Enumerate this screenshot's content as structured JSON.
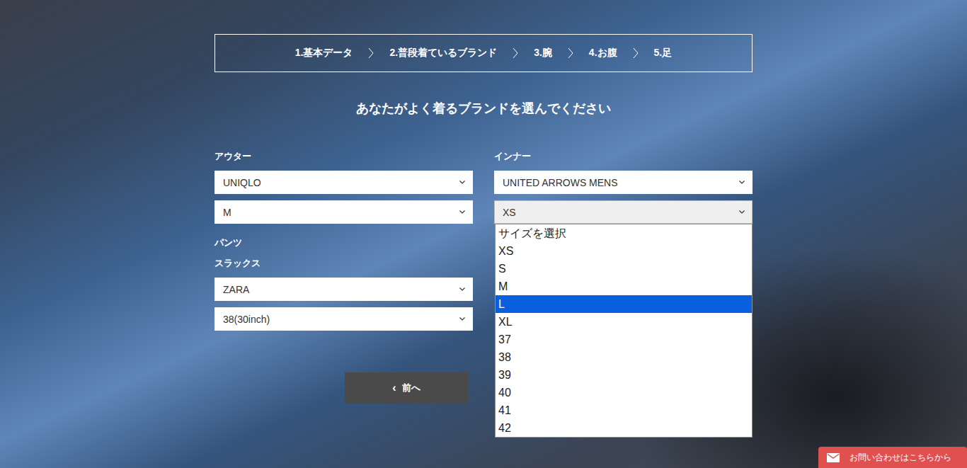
{
  "steps": [
    {
      "label": "1.基本データ"
    },
    {
      "label": "2.普段着ているブランド"
    },
    {
      "label": "3.腕"
    },
    {
      "label": "4.お腹"
    },
    {
      "label": "5.足"
    }
  ],
  "heading": "あなたがよく着るブランドを選んでください",
  "columns": [
    {
      "groups": [
        {
          "label": "アウター",
          "sublabel": "",
          "selects": [
            {
              "value": "UNIQLO",
              "open": false
            },
            {
              "value": "M",
              "open": false
            }
          ]
        },
        {
          "label": "パンツ",
          "sublabel": "スラックス",
          "selects": [
            {
              "value": "ZARA",
              "open": false
            },
            {
              "value": "38(30inch)",
              "open": false
            }
          ]
        }
      ]
    },
    {
      "groups": [
        {
          "label": "インナー",
          "sublabel": "",
          "selects": [
            {
              "value": "UNITED ARROWS MENS",
              "open": false
            },
            {
              "value": "XS",
              "open": true
            }
          ]
        }
      ]
    }
  ],
  "dropdown": {
    "options": [
      {
        "label": "サイズを選択",
        "selected": false
      },
      {
        "label": "XS",
        "selected": false
      },
      {
        "label": "S",
        "selected": false
      },
      {
        "label": "M",
        "selected": false
      },
      {
        "label": "L",
        "selected": true
      },
      {
        "label": "XL",
        "selected": false
      },
      {
        "label": "37",
        "selected": false
      },
      {
        "label": "38",
        "selected": false
      },
      {
        "label": "39",
        "selected": false
      },
      {
        "label": "40",
        "selected": false
      },
      {
        "label": "41",
        "selected": false
      },
      {
        "label": "42",
        "selected": false
      }
    ]
  },
  "back_button": {
    "icon": "‹",
    "label": "前へ"
  },
  "contact_button": {
    "label": "お問い合わせはこちらから"
  }
}
